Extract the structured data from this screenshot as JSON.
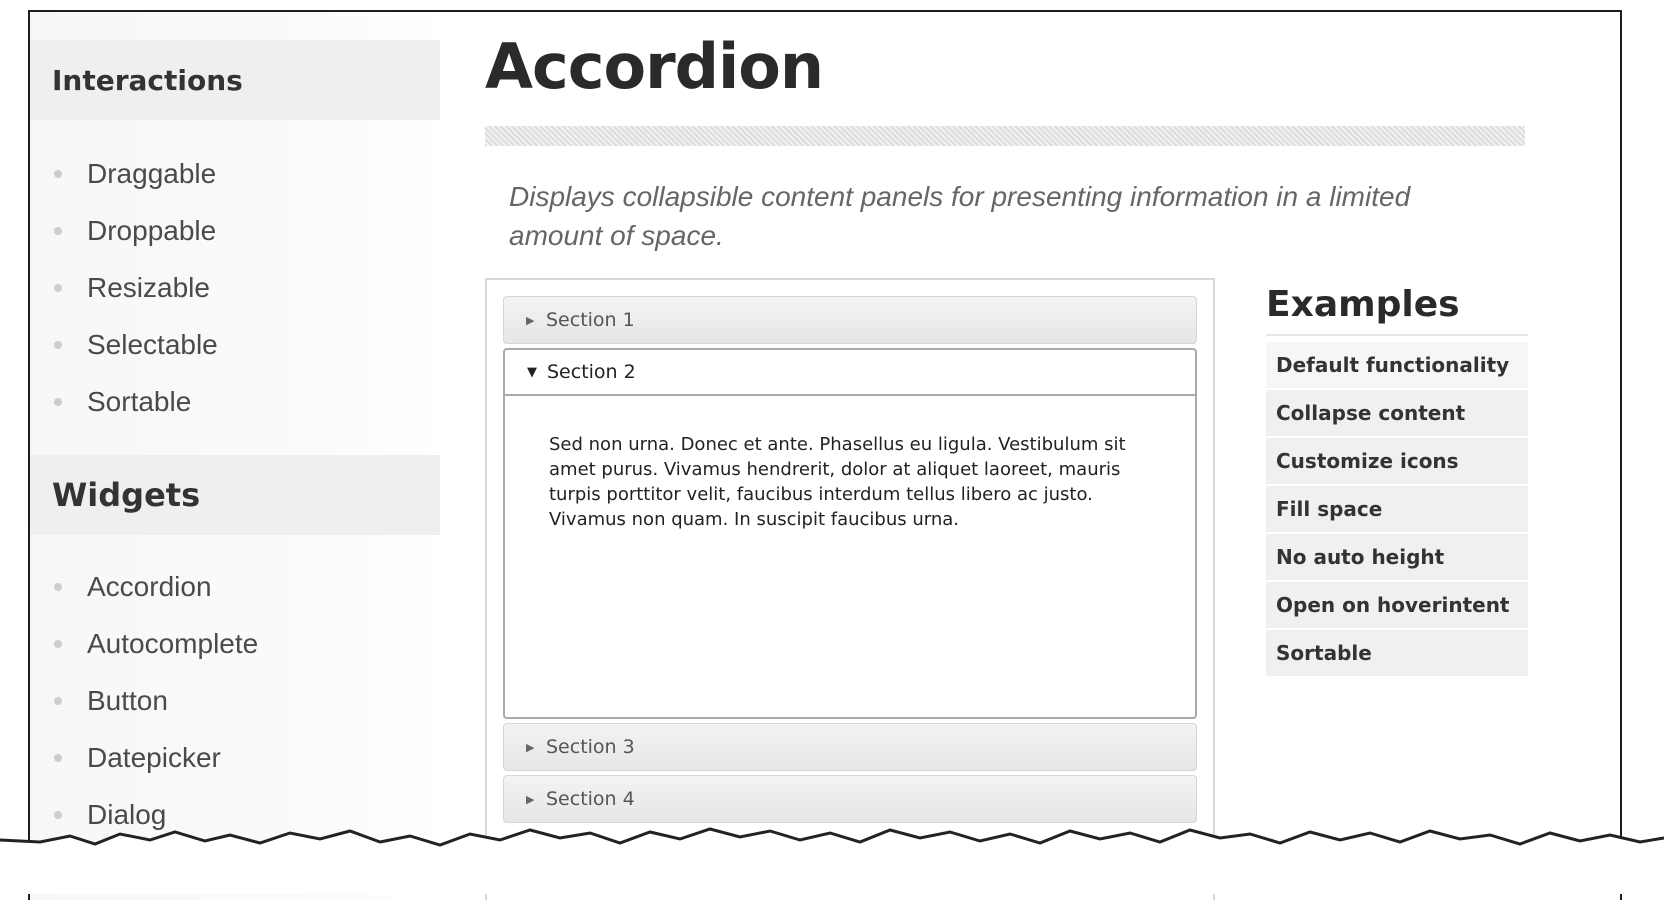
{
  "sidebar": {
    "interactions_heading": "Interactions",
    "interactions": [
      "Draggable",
      "Droppable",
      "Resizable",
      "Selectable",
      "Sortable"
    ],
    "widgets_heading": "Widgets",
    "widgets": [
      "Accordion",
      "Autocomplete",
      "Button",
      "Datepicker",
      "Dialog"
    ]
  },
  "main": {
    "title": "Accordion",
    "description": "Displays collapsible content panels for presenting information in a limited amount of space."
  },
  "accordion": {
    "sections": [
      "Section 1",
      "Section 2",
      "Section 3",
      "Section 4"
    ],
    "active_section": "Section 2",
    "active_content": "Sed non urna. Donec et ante. Phasellus eu ligula. Vestibulum sit amet purus. Vivamus hendrerit, dolor at aliquet laoreet, mauris turpis porttitor velit, faucibus interdum tellus libero ac justo. Vivamus non quam. In suscipit faucibus urna."
  },
  "examples": {
    "heading": "Examples",
    "items": [
      "Default functionality",
      "Collapse content",
      "Customize icons",
      "Fill space",
      "No auto height",
      "Open on hoverintent",
      "Sortable"
    ]
  },
  "colors": {
    "frame_border": "#1e1e1e",
    "heading_text": "#2a2a2a",
    "sidebar_heading_bg": "#efefef",
    "example_item_bg": "#f0f0f0"
  },
  "icons": {
    "collapsed": "triangle-right-icon",
    "expanded": "triangle-down-icon",
    "list_bullet": "bullet-icon"
  }
}
